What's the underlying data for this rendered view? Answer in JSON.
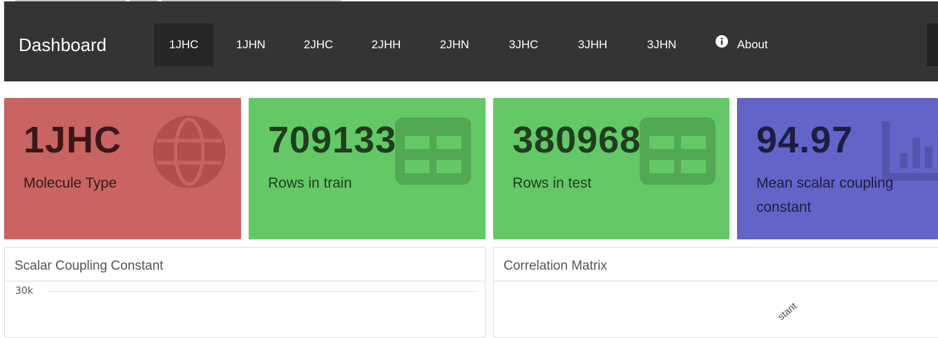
{
  "navbar": {
    "brand": "Dashboard",
    "items": [
      {
        "label": "1JHC",
        "active": true
      },
      {
        "label": "1JHN"
      },
      {
        "label": "2JHC"
      },
      {
        "label": "2JHH"
      },
      {
        "label": "2JHN"
      },
      {
        "label": "3JHC"
      },
      {
        "label": "3JHH"
      },
      {
        "label": "3JHN"
      },
      {
        "label": "About",
        "icon": "info-circle-icon"
      }
    ]
  },
  "cards": [
    {
      "value": "1JHC",
      "label": "Molecule Type",
      "icon": "globe-icon",
      "color": "#c96462"
    },
    {
      "value": "709133",
      "label": "Rows in train",
      "icon": "table-icon",
      "color": "#64c866"
    },
    {
      "value": "380968",
      "label": "Rows in test",
      "icon": "table-icon",
      "color": "#64c866"
    },
    {
      "value": "94.97",
      "label": "Mean scalar coupling constant",
      "icon": "bar-chart-icon",
      "color": "#6363c8"
    }
  ],
  "panels": {
    "scalar": {
      "title": "Scalar Coupling Constant",
      "y_tick": "30k"
    },
    "correlation": {
      "title": "Correlation Matrix",
      "partial_label": "stant"
    }
  }
}
